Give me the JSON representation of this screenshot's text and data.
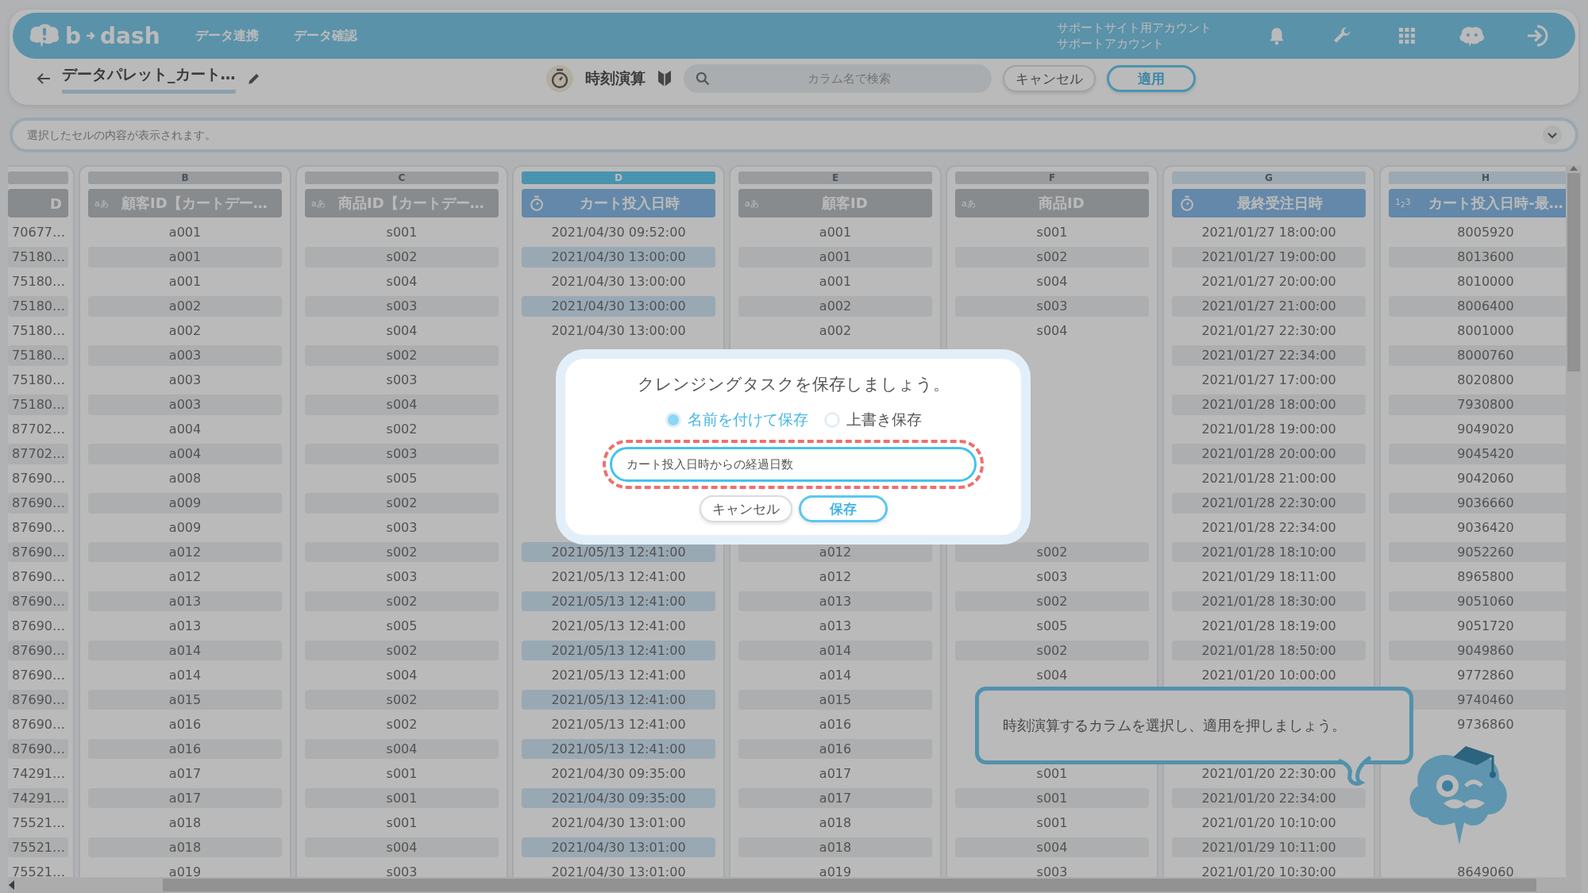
{
  "header": {
    "logo": {
      "left": "b",
      "right": "dash"
    },
    "nav": [
      {
        "label": "データ連携"
      },
      {
        "label": "データ確認"
      }
    ],
    "account": [
      "サポートサイト用アカウント",
      "サポートアカウント"
    ]
  },
  "toolbar": {
    "title": "データパレット_カート…",
    "mode": "時刻演算",
    "search": {
      "placeholder": "カラム名で検索"
    },
    "buttons": [
      {
        "label": "キャンセル",
        "kind": "secondary"
      },
      {
        "label": "適用",
        "kind": "primary"
      }
    ]
  },
  "cell_view": {
    "placeholder": "選択したセルの内容が表示されます。"
  },
  "columns": [
    {
      "kind": "partial",
      "header": "D",
      "selected": false,
      "highlighted": false,
      "cells": [
        "70677…",
        "75180…",
        "75180…",
        "75180…",
        "75180…",
        "75180…",
        "75180…",
        "75180…",
        "87702…",
        "87702…",
        "87690…",
        "87690…",
        "87690…",
        "87690…",
        "87690…",
        "87690…",
        "87690…",
        "87690…",
        "87690…",
        "87690…",
        "87690…",
        "87690…",
        "74291…",
        "74291…",
        "75521…",
        "75521…",
        "75521…"
      ]
    },
    {
      "kind": "text",
      "letter": "B",
      "type_mark": "aあ",
      "header": "顧客ID【カートデー…",
      "selected": false,
      "highlighted": false,
      "cells": [
        "a001",
        "a001",
        "a001",
        "a002",
        "a002",
        "a003",
        "a003",
        "a003",
        "a004",
        "a004",
        "a008",
        "a009",
        "a009",
        "a012",
        "a012",
        "a013",
        "a013",
        "a014",
        "a014",
        "a015",
        "a016",
        "a016",
        "a017",
        "a017",
        "a018",
        "a018",
        "a019"
      ]
    },
    {
      "kind": "text",
      "letter": "C",
      "type_mark": "aあ",
      "header": "商品ID【カートデー…",
      "selected": false,
      "highlighted": false,
      "cells": [
        "s001",
        "s002",
        "s004",
        "s003",
        "s004",
        "s002",
        "s003",
        "s004",
        "s002",
        "s003",
        "s005",
        "s002",
        "s003",
        "s002",
        "s003",
        "s002",
        "s005",
        "s002",
        "s004",
        "s002",
        "s002",
        "s004",
        "s001",
        "s001",
        "s001",
        "s004",
        "s003"
      ]
    },
    {
      "kind": "datetime",
      "letter": "D",
      "header": "カート投入日時",
      "selected": true,
      "highlighted": true,
      "cells": [
        "2021/04/30 09:52:00",
        "2021/04/30 13:00:00",
        "2021/04/30 13:00:00",
        "2021/04/30 13:00:00",
        "2021/04/30 13:00:00",
        null,
        null,
        null,
        null,
        null,
        null,
        null,
        null,
        "2021/05/13 12:41:00",
        "2021/05/13 12:41:00",
        "2021/05/13 12:41:00",
        "2021/05/13 12:41:00",
        "2021/05/13 12:41:00",
        "2021/05/13 12:41:00",
        "2021/05/13 12:41:00",
        "2021/05/13 12:41:00",
        "2021/05/13 12:41:00",
        "2021/04/30 09:35:00",
        "2021/04/30 09:35:00",
        "2021/04/30 13:01:00",
        "2021/04/30 13:01:00",
        "2021/04/30 13:01:00"
      ]
    },
    {
      "kind": "text",
      "letter": "E",
      "type_mark": "aあ",
      "header": "顧客ID",
      "selected": false,
      "highlighted": false,
      "cells": [
        "a001",
        "a001",
        "a001",
        "a002",
        "a002",
        null,
        null,
        null,
        null,
        null,
        null,
        null,
        null,
        "a012",
        "a012",
        "a013",
        "a013",
        "a014",
        "a014",
        "a015",
        "a016",
        "a016",
        "a017",
        "a017",
        "a018",
        "a018",
        "a019"
      ]
    },
    {
      "kind": "text",
      "letter": "F",
      "type_mark": "aあ",
      "header": "商品ID",
      "selected": false,
      "highlighted": false,
      "cells": [
        "s001",
        "s002",
        "s004",
        "s003",
        "s004",
        null,
        null,
        null,
        null,
        null,
        null,
        null,
        null,
        "s002",
        "s003",
        "s002",
        "s005",
        "s002",
        "s004",
        null,
        null,
        null,
        "s001",
        "s001",
        "s001",
        "s004",
        "s003"
      ]
    },
    {
      "kind": "datetime",
      "letter": "G",
      "header": "最終受注日時",
      "selected": false,
      "highlighted": true,
      "cells": [
        "2021/01/27 18:00:00",
        "2021/01/27 19:00:00",
        "2021/01/27 20:00:00",
        "2021/01/27 21:00:00",
        "2021/01/27 22:30:00",
        "2021/01/27 22:34:00",
        "2021/01/27 17:00:00",
        "2021/01/28 18:00:00",
        "2021/01/28 19:00:00",
        "2021/01/28 20:00:00",
        "2021/01/28 21:00:00",
        "2021/01/28 22:30:00",
        "2021/01/28 22:34:00",
        "2021/01/28 18:10:00",
        "2021/01/29 18:11:00",
        "2021/01/28 18:30:00",
        "2021/01/28 18:19:00",
        "2021/01/28 18:50:00",
        "2021/01/20 10:00:00",
        null,
        null,
        null,
        "2021/01/20 22:30:00",
        "2021/01/20 22:34:00",
        "2021/01/20 10:10:00",
        "2021/01/29 10:11:00",
        "2021/01/20 10:30:00"
      ]
    },
    {
      "kind": "number",
      "letter": "H",
      "type_mark": "1$_{2}$3",
      "header": "カート投入日時-最…",
      "selected": false,
      "highlighted": true,
      "cells": [
        "8005920",
        "8013600",
        "8010000",
        "8006400",
        "8001000",
        "8000760",
        "8020800",
        "7930800",
        "9049020",
        "9045420",
        "9042060",
        "9036660",
        "9036420",
        "9052260",
        "8965800",
        "9051060",
        "9051720",
        "9049860",
        "9772860",
        "9740460",
        "9736860",
        null,
        null,
        null,
        null,
        null,
        "8649060"
      ]
    }
  ],
  "dialog": {
    "title": "クレンジングタスクを保存しましょう。",
    "options": [
      {
        "label": "名前を付けて保存",
        "selected": true
      },
      {
        "label": "上書き保存",
        "selected": false
      }
    ],
    "name_field": {
      "value": "カート投入日時からの経過日数",
      "highlighted": true
    },
    "buttons": [
      {
        "label": "キャンセル",
        "kind": "secondary"
      },
      {
        "label": "保存",
        "kind": "primary"
      }
    ]
  },
  "guide": {
    "message": "時刻演算するカラムを選択し、適用を押しましょう。"
  }
}
